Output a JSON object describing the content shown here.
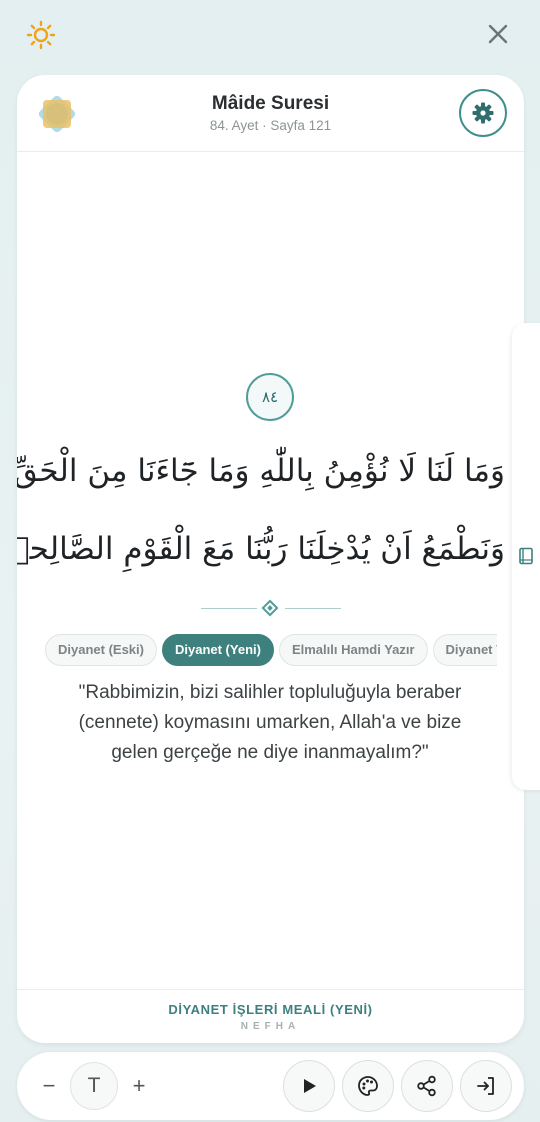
{
  "header": {
    "title": "Mâide Suresi",
    "subtitle": "84. Ayet · Sayfa 121"
  },
  "ayah": {
    "number": "٨٤",
    "line1": "وَمَا لَنَا لَا نُؤْمِنُ بِاللّٰهِ وَمَا جَٓاءَنَا مِنَ الْحَقِّۙ",
    "line2": "وَنَطْمَعُ اَنْ يُدْخِلَنَا رَبُّنَا مَعَ الْقَوْمِ الصَّالِح۪ينَ"
  },
  "tabs": [
    {
      "label": "Diyanet (Eski)",
      "active": false
    },
    {
      "label": "Diyanet (Yeni)",
      "active": true
    },
    {
      "label": "Elmalılı Hamdi Yazır",
      "active": false
    },
    {
      "label": "Diyanet Vakfı",
      "active": false
    }
  ],
  "translation": "\"Rabbimizin, bizi salihler topluluğuyla beraber (cennete) koymasını umarken, Allah'a ve bize gelen gerçeğe ne diye inanmayalım?\"",
  "footer": {
    "source": "DİYANET İŞLERİ MEALİ (YENİ)",
    "brand": "NEFHA"
  },
  "toolbar": {
    "minus": "−",
    "font_label": "T",
    "plus": "+"
  },
  "icons": {
    "theme": "sun-icon",
    "close": "close-icon",
    "logo": "nefha-logo-icon",
    "settings": "gear-icon",
    "side": "book-icon",
    "play": "play-icon",
    "palette": "palette-icon",
    "share": "share-icon",
    "exit": "exit-icon"
  },
  "colors": {
    "accent": "#3d807e",
    "sun": "#f2a21b",
    "allah": "#c0392b",
    "madd": "#c0392b",
    "lam_alif": "#1f5fa8",
    "idgham": "#7d3c98",
    "qalqala": "#b9770e"
  }
}
